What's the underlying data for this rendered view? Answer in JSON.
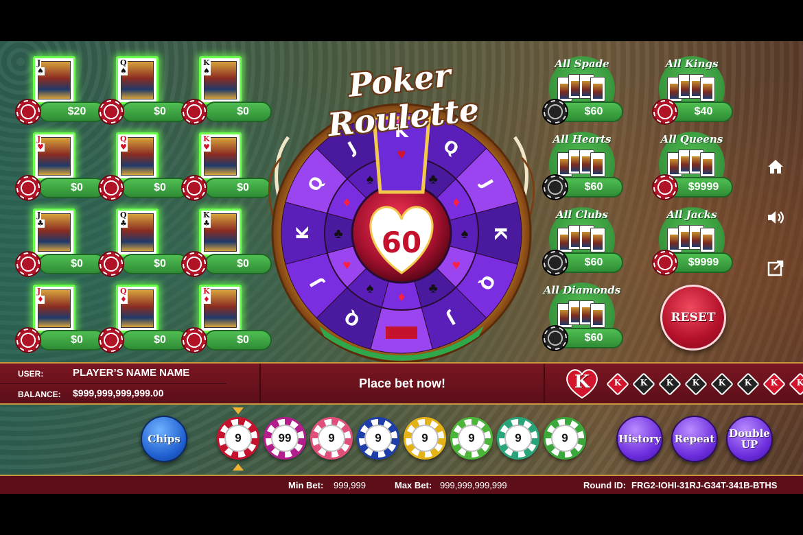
{
  "bet_grid": [
    {
      "rank": "J",
      "suit": "♠",
      "red": false,
      "amount": "$20"
    },
    {
      "rank": "Q",
      "suit": "♠",
      "red": false,
      "amount": "$0"
    },
    {
      "rank": "K",
      "suit": "♠",
      "red": false,
      "amount": "$0"
    },
    {
      "rank": "J",
      "suit": "♥",
      "red": true,
      "amount": "$0"
    },
    {
      "rank": "Q",
      "suit": "♥",
      "red": true,
      "amount": "$0"
    },
    {
      "rank": "K",
      "suit": "♥",
      "red": true,
      "amount": "$0"
    },
    {
      "rank": "J",
      "suit": "♣",
      "red": false,
      "amount": "$0"
    },
    {
      "rank": "Q",
      "suit": "♣",
      "red": false,
      "amount": "$0"
    },
    {
      "rank": "K",
      "suit": "♣",
      "red": false,
      "amount": "$0"
    },
    {
      "rank": "J",
      "suit": "♦",
      "red": true,
      "amount": "$0"
    },
    {
      "rank": "Q",
      "suit": "♦",
      "red": true,
      "amount": "$0"
    },
    {
      "rank": "K",
      "suit": "♦",
      "red": true,
      "amount": "$0"
    }
  ],
  "logo": "Poker Roulette",
  "wheel": {
    "center_value": "60",
    "outer_ring": [
      "K",
      "Q",
      "J",
      "K",
      "Q",
      "J",
      "K",
      "Q",
      "J",
      "K",
      "Q",
      "J"
    ],
    "pointer_label": "K"
  },
  "side_bets": [
    {
      "title": "All Spade",
      "amount": "$60",
      "chip": "black"
    },
    {
      "title": "All Kings",
      "amount": "$40",
      "chip": "red"
    },
    {
      "title": "All Hearts",
      "amount": "$60",
      "chip": "black"
    },
    {
      "title": "All Queens",
      "amount": "$9999",
      "chip": "red"
    },
    {
      "title": "All Clubs",
      "amount": "$60",
      "chip": "black"
    },
    {
      "title": "All Jacks",
      "amount": "$9999",
      "chip": "red"
    },
    {
      "title": "All Diamonds",
      "amount": "$60",
      "chip": "black"
    }
  ],
  "reset_label": "RESET",
  "icons": [
    "home-icon",
    "sound-icon",
    "fullscreen-icon"
  ],
  "info": {
    "user_label": "USER:",
    "user_name": "PLAYER’S NAME NAME",
    "balance_label": "BALANCE:",
    "balance": "$999,999,999,999.00",
    "status": "Place bet now!"
  },
  "history": {
    "latest": "K",
    "items": [
      {
        "rank": "K",
        "suit": "♦"
      },
      {
        "rank": "K",
        "suit": "♣"
      },
      {
        "rank": "K",
        "suit": "♠"
      },
      {
        "rank": "K",
        "suit": "♠"
      },
      {
        "rank": "K",
        "suit": "♠"
      },
      {
        "rank": "K",
        "suit": "♠"
      },
      {
        "rank": "K",
        "suit": "♦"
      },
      {
        "rank": "K",
        "suit": "♦"
      }
    ]
  },
  "chips_button": "Chips",
  "chips": [
    {
      "value": "9",
      "color": "#c4122f"
    },
    {
      "value": "99",
      "color": "#b41e8c"
    },
    {
      "value": "9",
      "color": "#e0507a"
    },
    {
      "value": "9",
      "color": "#1f3fa8"
    },
    {
      "value": "9",
      "color": "#e3b318"
    },
    {
      "value": "9",
      "color": "#4cb63a"
    },
    {
      "value": "9",
      "color": "#2aa57a"
    },
    {
      "value": "9",
      "color": "#3aa83a"
    }
  ],
  "action_buttons": {
    "history": "History",
    "repeat": "Repeat",
    "double_up_line1": "Double",
    "double_up_line2": "UP"
  },
  "footer": {
    "min_bet_label": "Min Bet:",
    "min_bet": "999,999",
    "max_bet_label": "Max Bet:",
    "max_bet": "999,999,999,999",
    "round_id_label": "Round ID:",
    "round_id": "FRG2-IOHI-31RJ-G34T-341B-BTHS"
  }
}
